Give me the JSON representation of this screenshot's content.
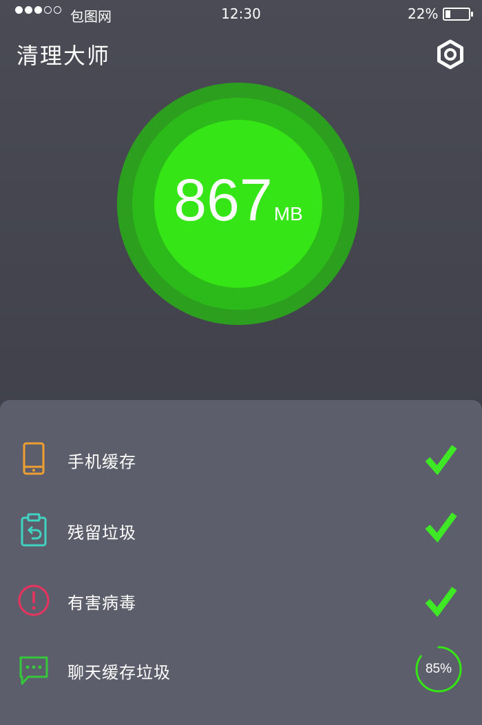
{
  "status_bar": {
    "carrier": "包图网",
    "time": "12:30",
    "battery_percent": "22%",
    "battery_level": 0.22,
    "signal_bars_filled": 3,
    "signal_bars_total": 5
  },
  "header": {
    "title": "清理大师",
    "settings_icon": "settings-hexagon-icon"
  },
  "gauge": {
    "value": "867",
    "unit": "MB",
    "colors": {
      "outer": "#2d9f1e",
      "middle": "#2cba1b",
      "inner": "#35e515"
    }
  },
  "scan_items": [
    {
      "label": "手机缓存",
      "icon": "phone-icon",
      "icon_color": "#f0a030",
      "status": "done"
    },
    {
      "label": "残留垃圾",
      "icon": "clipboard-icon",
      "icon_color": "#3fd3c2",
      "status": "done"
    },
    {
      "label": "有害病毒",
      "icon": "warning-icon",
      "icon_color": "#e8335f",
      "status": "done"
    },
    {
      "label": "聊天缓存垃圾",
      "icon": "chat-icon",
      "icon_color": "#35c83a",
      "status": "in-progress",
      "progress_text": "85%",
      "progress": 0.85
    }
  ],
  "colors": {
    "accent": "#35e515",
    "check": "#3ee825",
    "background": "#454650",
    "panel": "#5c5e6c"
  }
}
